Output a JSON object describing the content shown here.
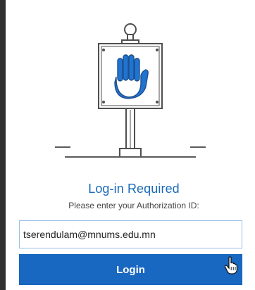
{
  "login": {
    "title": "Log-in Required",
    "subtitle": "Please enter your Authorization ID:",
    "id_value": "tserendulam@mnums.edu.mn",
    "button_label": "Login"
  },
  "icons": {
    "illustration": "stop-hand-sign-icon",
    "cursor": "hand-pointer-icon"
  },
  "colors": {
    "accent": "#1867c1",
    "title": "#1a6ab8",
    "input_border": "#97bfe6",
    "hand": "#1f74d0",
    "line": "#5b5b5b"
  }
}
